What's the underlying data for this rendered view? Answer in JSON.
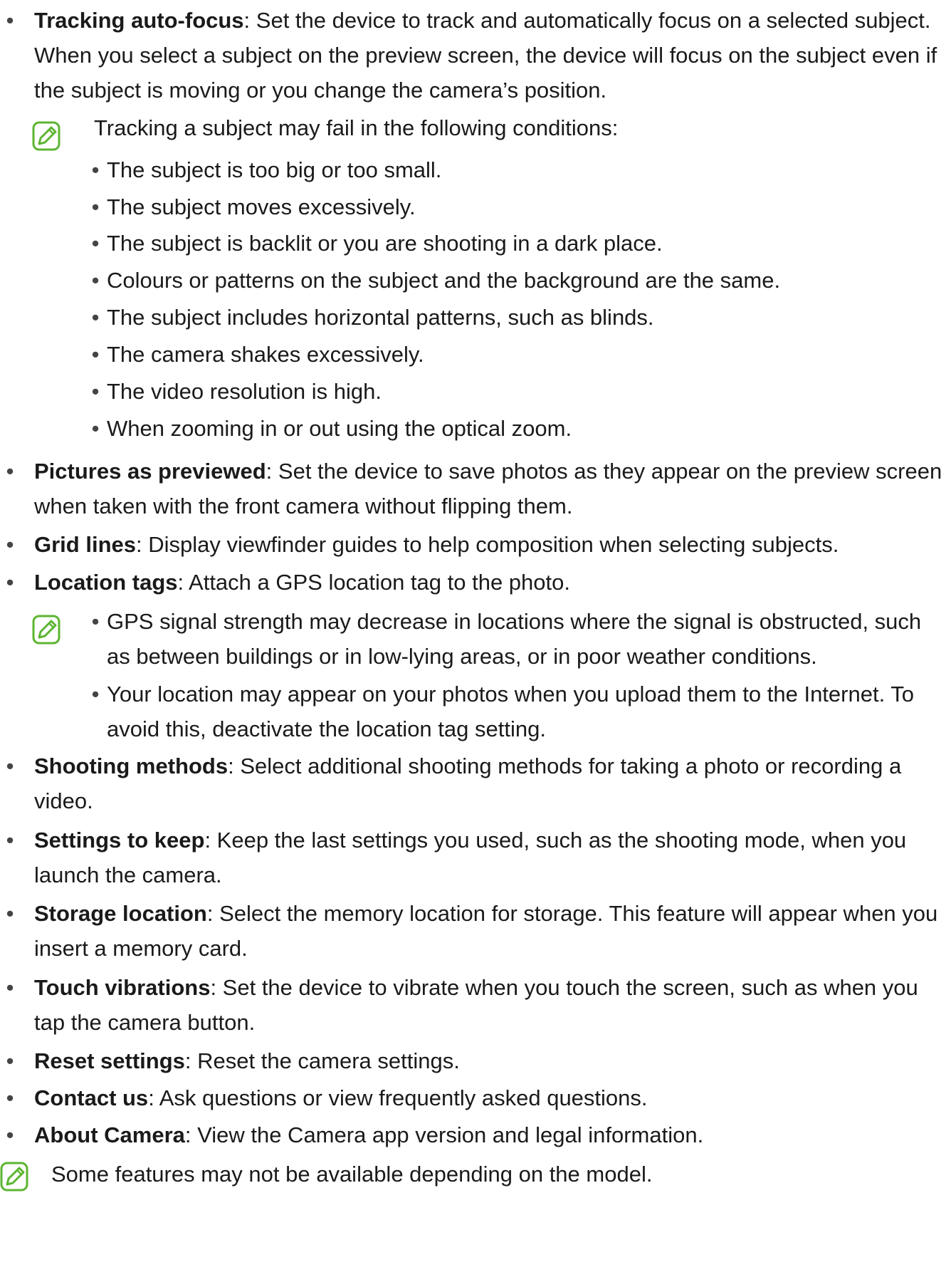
{
  "items": {
    "tracking": {
      "term": "Tracking auto-focus",
      "desc": ": Set the device to track and automatically focus on a selected subject. When you select a subject on the preview screen, the device will focus on the subject even if the subject is moving or you change the camera’s position."
    },
    "tracking_note": {
      "intro": "Tracking a subject may fail in the following conditions:",
      "conditions": [
        "The subject is too big or too small.",
        "The subject moves excessively.",
        "The subject is backlit or you are shooting in a dark place.",
        "Colours or patterns on the subject and the background are the same.",
        "The subject includes horizontal patterns, such as blinds.",
        "The camera shakes excessively.",
        "The video resolution is high.",
        "When zooming in or out using the optical zoom."
      ]
    },
    "pictures": {
      "term": "Pictures as previewed",
      "desc": ": Set the device to save photos as they appear on the preview screen when taken with the front camera without flipping them."
    },
    "grid": {
      "term": "Grid lines",
      "desc": ": Display viewfinder guides to help composition when selecting subjects."
    },
    "location": {
      "term": "Location tags",
      "desc": ": Attach a GPS location tag to the photo."
    },
    "location_note": [
      "GPS signal strength may decrease in locations where the signal is obstructed, such as between buildings or in low-lying areas, or in poor weather conditions.",
      "Your location may appear on your photos when you upload them to the Internet. To avoid this, deactivate the location tag setting."
    ],
    "shooting": {
      "term": "Shooting methods",
      "desc": ": Select additional shooting methods for taking a photo or recording a video."
    },
    "keep": {
      "term": "Settings to keep",
      "desc": ": Keep the last settings you used, such as the shooting mode, when you launch the camera."
    },
    "storage": {
      "term": "Storage location",
      "desc": ": Select the memory location for storage. This feature will appear when you insert a memory card."
    },
    "touch": {
      "term": "Touch vibrations",
      "desc": ": Set the device to vibrate when you touch the screen, such as when you tap the camera button."
    },
    "reset": {
      "term": "Reset settings",
      "desc": ": Reset the camera settings."
    },
    "contact": {
      "term": "Contact us",
      "desc": ": Ask questions or view frequently asked questions."
    },
    "about": {
      "term": "About Camera",
      "desc": ": View the Camera app version and legal information."
    }
  },
  "footer_note": "Some features may not be available depending on the model.",
  "colors": {
    "note_icon": "#5cb531",
    "text": "#1a1a1a"
  },
  "icons": {
    "bullet": "•",
    "note": "note-pen-icon"
  }
}
